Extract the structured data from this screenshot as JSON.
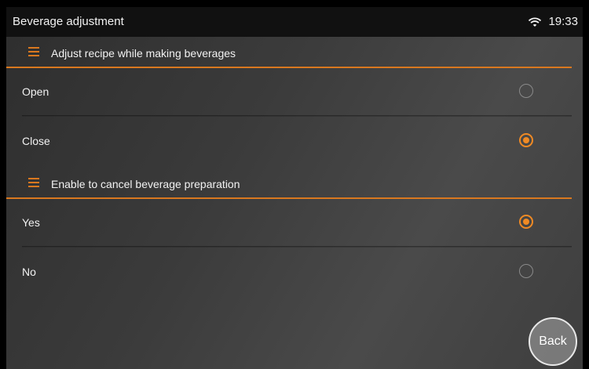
{
  "header": {
    "title": "Beverage adjustment",
    "time": "19:33",
    "wifi_icon": "wifi-icon"
  },
  "sections": [
    {
      "label": "Adjust recipe while making beverages",
      "options": [
        {
          "label": "Open",
          "selected": false
        },
        {
          "label": "Close",
          "selected": true
        }
      ]
    },
    {
      "label": "Enable to cancel beverage preparation",
      "options": [
        {
          "label": "Yes",
          "selected": true
        },
        {
          "label": "No",
          "selected": false
        }
      ]
    }
  ],
  "back_label": "Back",
  "colors": {
    "accent": "#f08a24",
    "header_bg": "#111111"
  }
}
